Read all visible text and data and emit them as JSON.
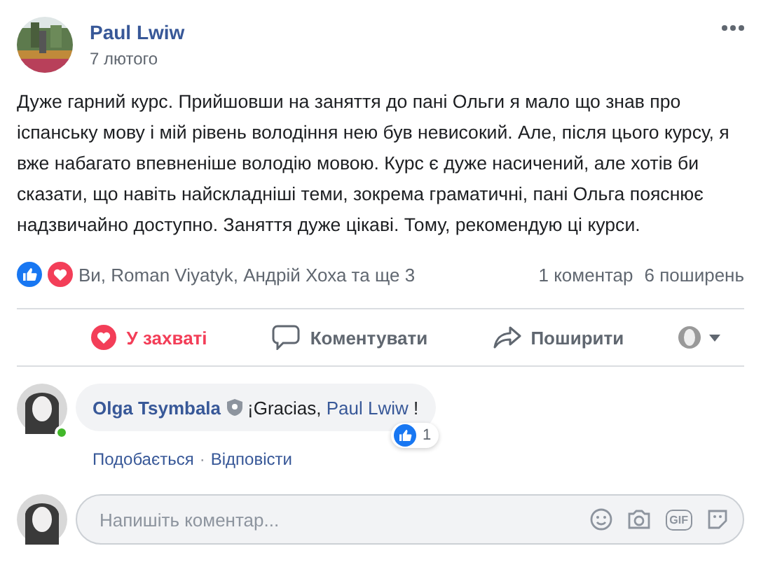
{
  "post": {
    "author": "Paul Lwiw",
    "date": "7 лютого",
    "text": "Дуже гарний курс. Прийшовши на заняття до пані Ольги я мало що знав про іспанську мову і мій рівень володіння нею був невисокий. Але, після цього курсу, я вже набагато впевненіше володію мовою. Курс є дуже насичений, але хотів би сказати, що навіть найскладніші теми, зокрема граматичні, пані Ольга пояснює надзвичайно доступно. Заняття дуже цікаві. Тому, рекомендую ці курси."
  },
  "reactions": {
    "summary": "Ви, Roman Viyatyk, Андрій Хоха та ще 3",
    "comments": "1 коментар",
    "shares": "6 поширень"
  },
  "actions": [
    {
      "kind": "react",
      "label": "У захваті",
      "selected": true
    },
    {
      "kind": "comment",
      "label": "Коментувати",
      "selected": false
    },
    {
      "kind": "share",
      "label": "Поширити",
      "selected": false
    }
  ],
  "comment": {
    "author": "Olga Tsymbala",
    "online": true,
    "text_before": "¡Gracias, ",
    "mention": "Paul Lwiw",
    "text_after": " !",
    "like_count": "1",
    "links": [
      "Подобається",
      "Відповісти"
    ],
    "link_separator": "·"
  },
  "composer": {
    "placeholder": "Напишіть коментар...",
    "gif_label": "GIF"
  }
}
